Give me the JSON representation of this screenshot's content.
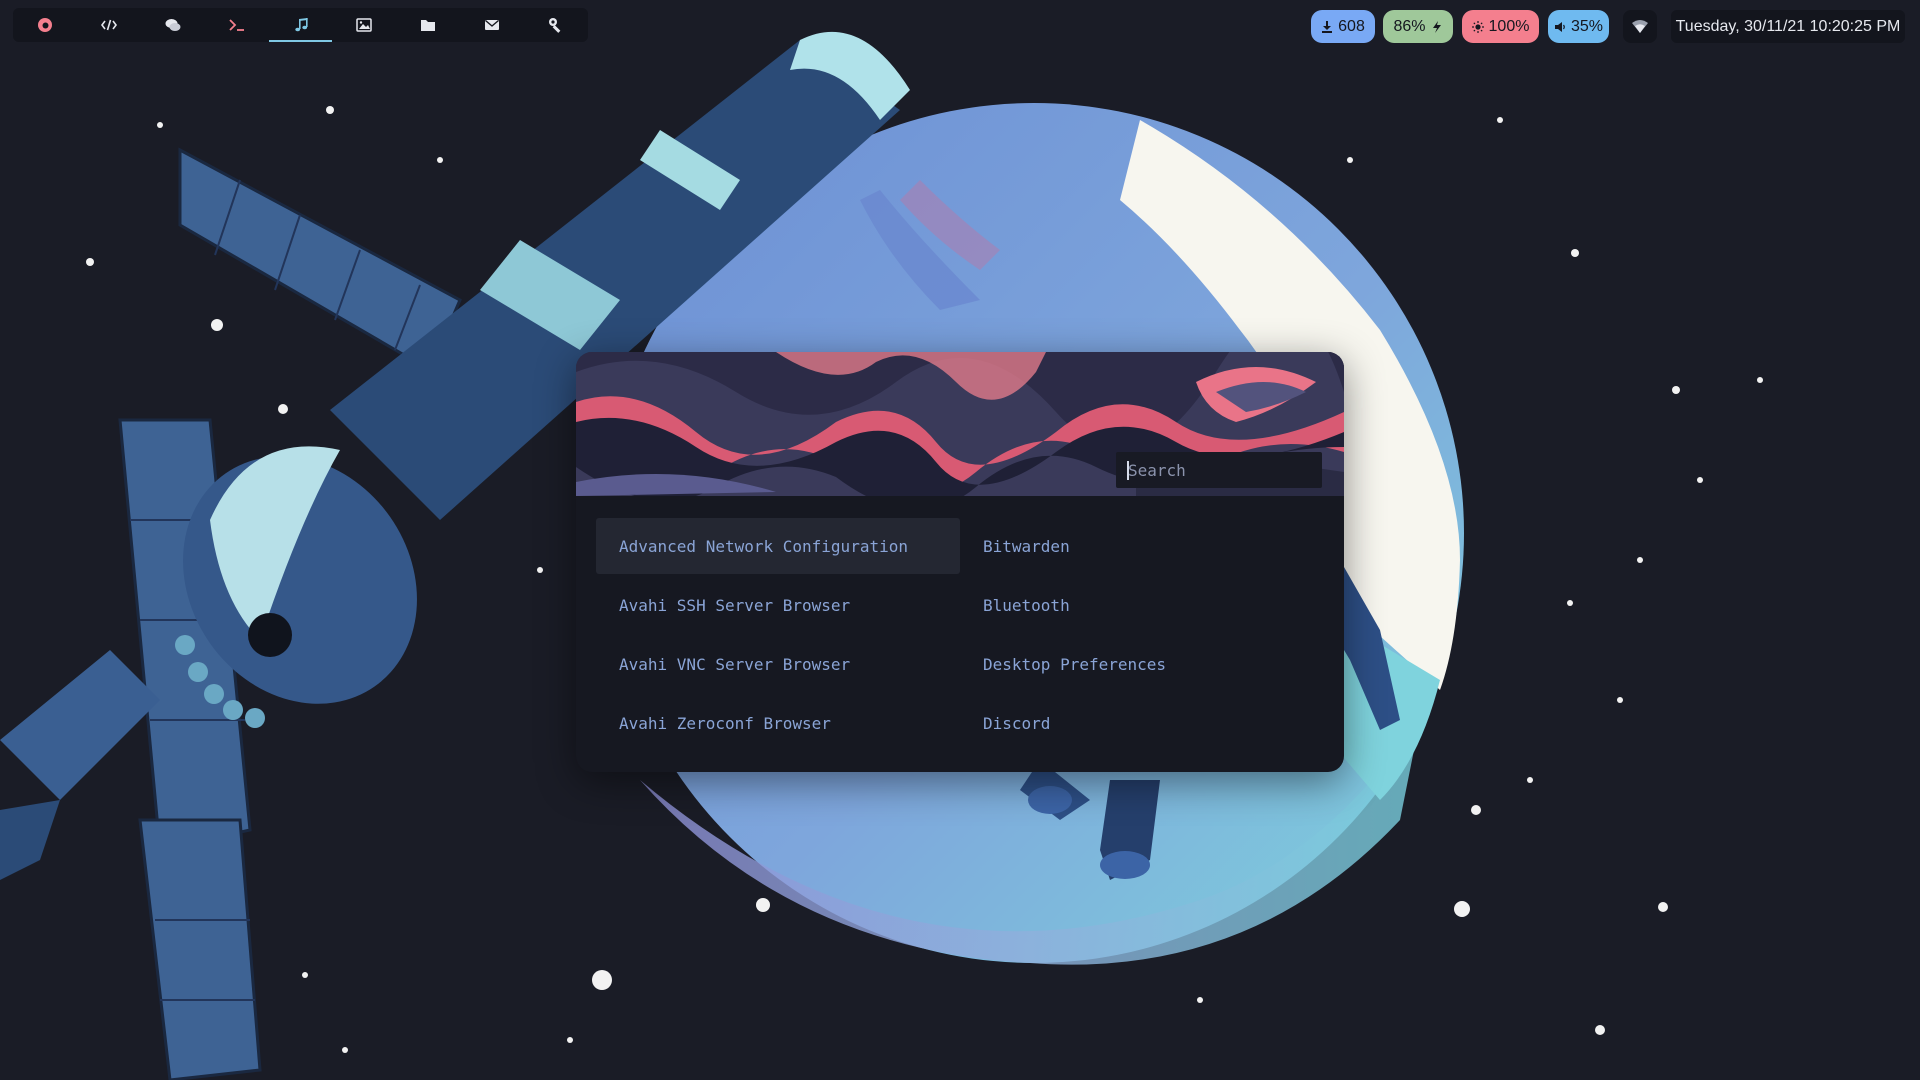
{
  "workspaces": [
    {
      "icon": "firefox-icon",
      "active": false
    },
    {
      "icon": "code-icon",
      "active": false
    },
    {
      "icon": "chat-icon",
      "active": false
    },
    {
      "icon": "terminal-icon",
      "active": false
    },
    {
      "icon": "music-icon",
      "active": true
    },
    {
      "icon": "image-icon",
      "active": false
    },
    {
      "icon": "folder-icon",
      "active": false
    },
    {
      "icon": "mail-icon",
      "active": false
    },
    {
      "icon": "tools-icon",
      "active": false
    }
  ],
  "status": {
    "updates": {
      "icon": "download-icon",
      "value": "608",
      "color": "#79a9f5"
    },
    "battery": {
      "icon": "plug-icon",
      "value": "86%",
      "color": "#9fc89a"
    },
    "brightness": {
      "icon": "sun-icon",
      "value": "100%",
      "color": "#f47f8e"
    },
    "volume": {
      "icon": "speaker-icon",
      "value": "35%",
      "color": "#6fbaf0"
    },
    "wifi": {
      "icon": "wifi-icon"
    },
    "clock": "Tuesday, 30/11/21 10:20:25 PM"
  },
  "launcher": {
    "search_placeholder": "Search",
    "apps": [
      {
        "label": "Advanced Network Configuration",
        "selected": true
      },
      {
        "label": "Bitwarden",
        "selected": false
      },
      {
        "label": "Avahi SSH Server Browser",
        "selected": false
      },
      {
        "label": "Bluetooth",
        "selected": false
      },
      {
        "label": "Avahi VNC Server Browser",
        "selected": false
      },
      {
        "label": "Desktop Preferences",
        "selected": false
      },
      {
        "label": "Avahi Zeroconf Browser",
        "selected": false
      },
      {
        "label": "Discord",
        "selected": false
      }
    ]
  },
  "colors": {
    "accent": "#7fc8e4",
    "app_text": "#8aa4d6",
    "panel": "#161821",
    "bar": "#13151d"
  }
}
